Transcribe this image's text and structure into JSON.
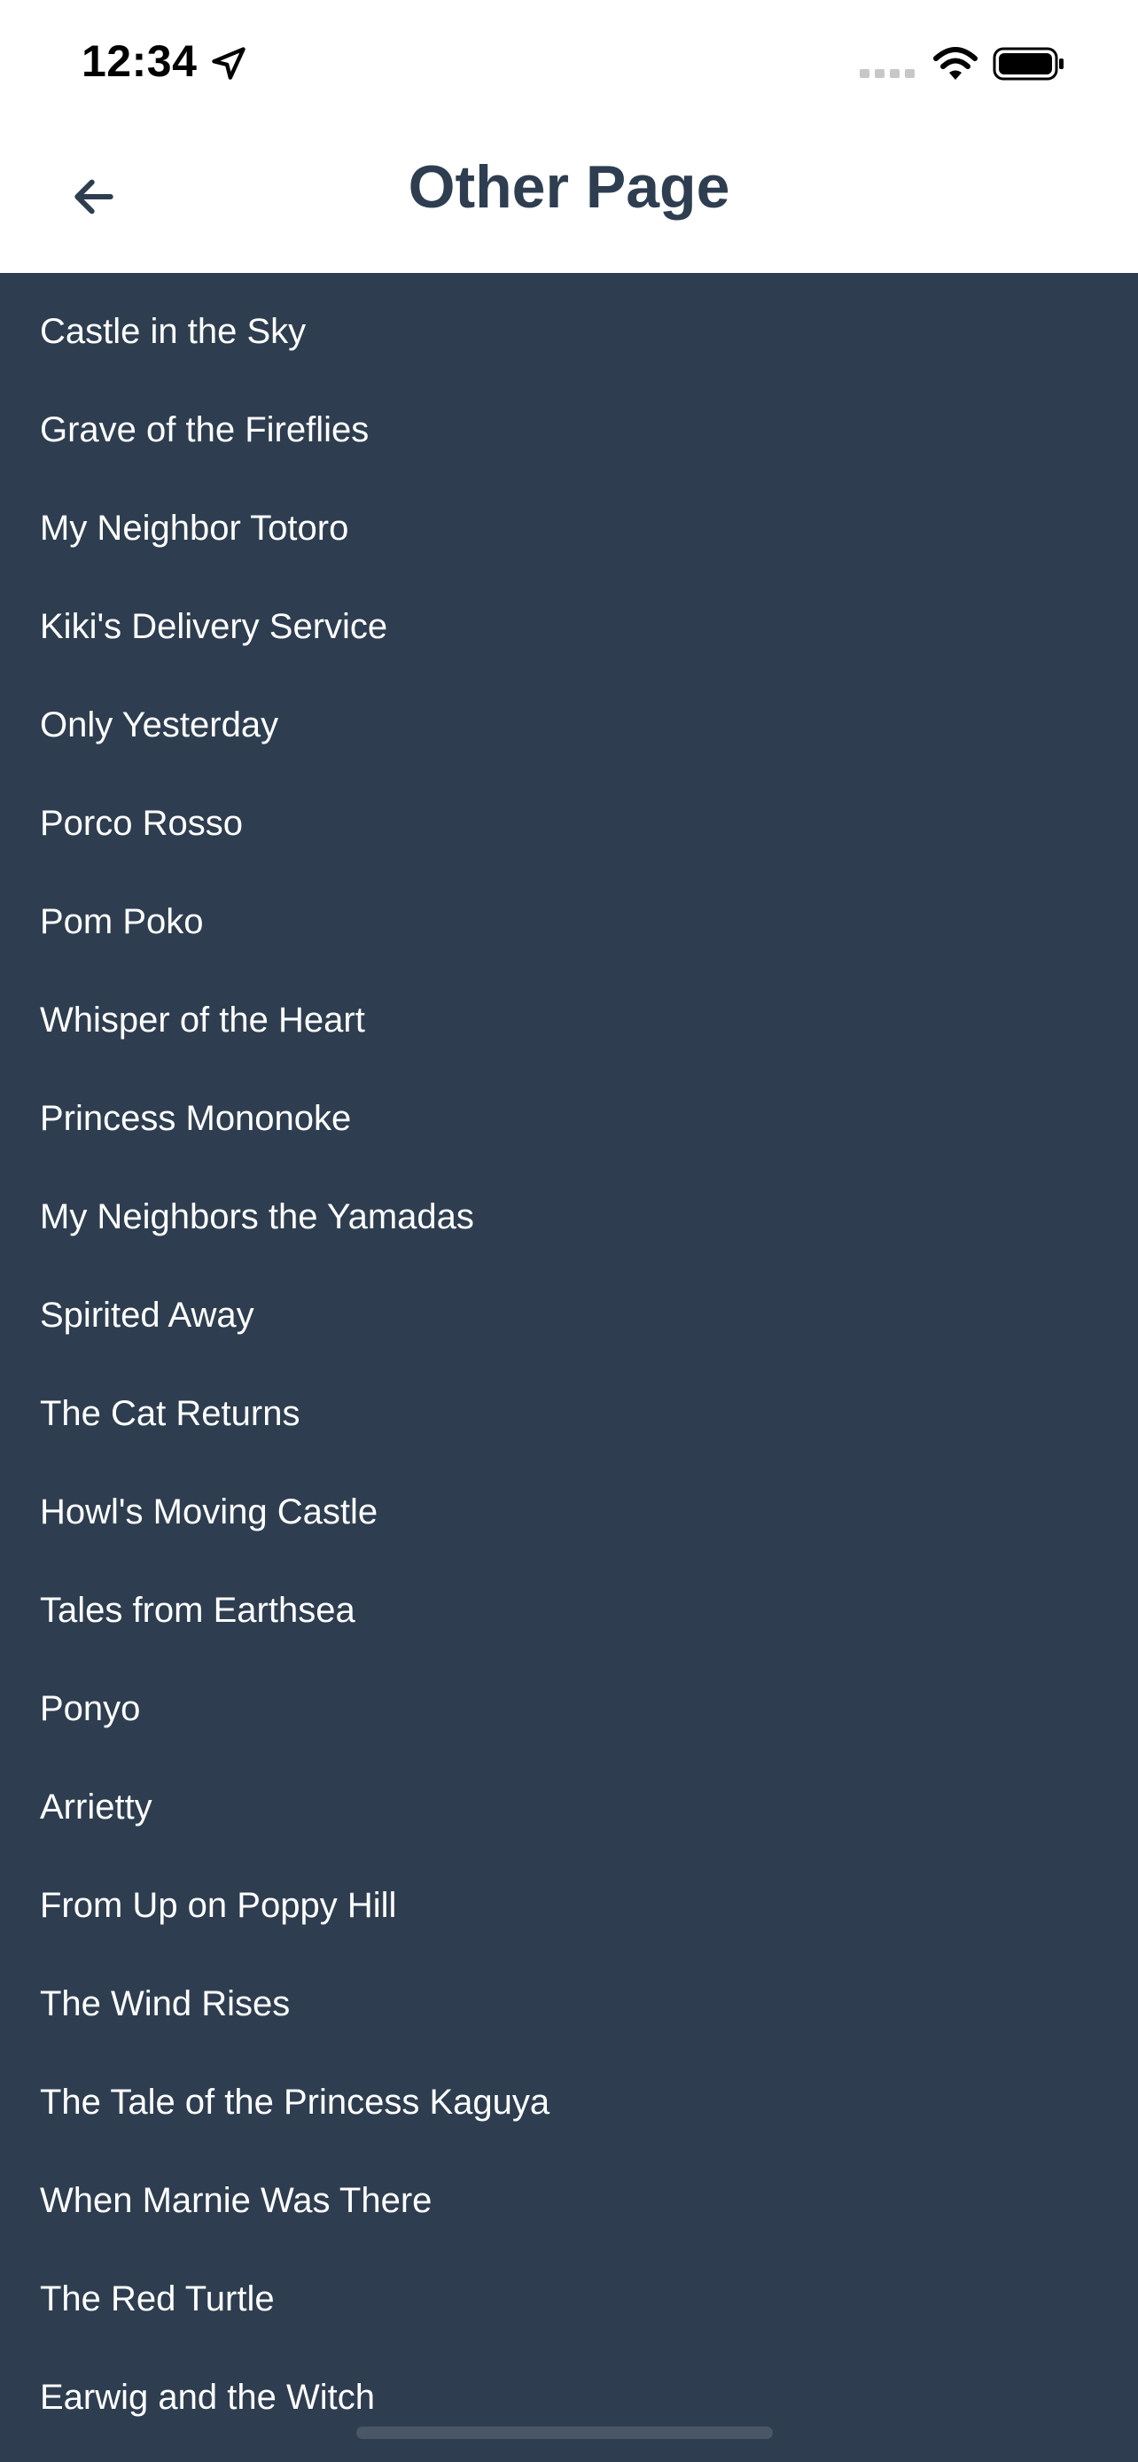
{
  "status_bar": {
    "time": "12:34"
  },
  "header": {
    "title": "Other Page"
  },
  "films": [
    "Castle in the Sky",
    "Grave of the Fireflies",
    "My Neighbor Totoro",
    "Kiki's Delivery Service",
    "Only Yesterday",
    "Porco Rosso",
    "Pom Poko",
    "Whisper of the Heart",
    "Princess Mononoke",
    "My Neighbors the Yamadas",
    "Spirited Away",
    "The Cat Returns",
    "Howl's Moving Castle",
    "Tales from Earthsea",
    "Ponyo",
    "Arrietty",
    "From Up on Poppy Hill",
    "The Wind Rises",
    "The Tale of the Princess Kaguya",
    "When Marnie Was There",
    "The Red Turtle",
    "Earwig and the Witch"
  ],
  "colors": {
    "header_bg": "#ffffff",
    "list_bg": "#2e3e50",
    "title": "#2e3e50",
    "item_text": "#ffffff"
  },
  "icons": {
    "back": "arrow-left-icon",
    "location": "location-arrow-icon",
    "signal": "cellular-signal-icon",
    "wifi": "wifi-icon",
    "battery": "battery-icon"
  }
}
